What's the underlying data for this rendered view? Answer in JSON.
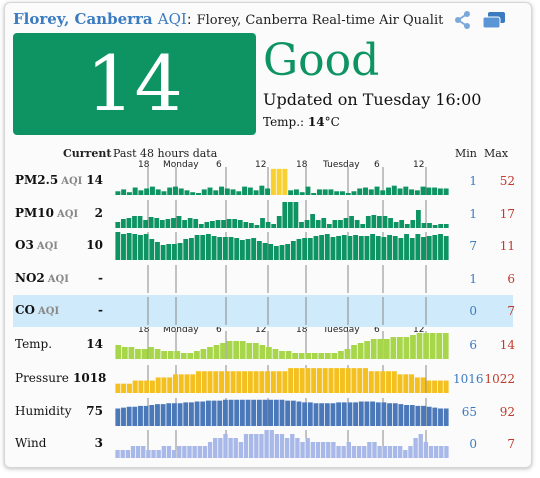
{
  "header": {
    "city": "Florey, Canberra",
    "aqi_word": "AQI",
    "colon": ":",
    "title": "Florey, Canberra Real-time Air Qualit"
  },
  "aqi": {
    "value": "14",
    "level": "Good",
    "updated": "Updated on Tuesday 16:00",
    "temp_label": "Temp.:",
    "temp_value": "14",
    "temp_unit": "°C",
    "color": "#0e9463"
  },
  "columns": {
    "current": "Current",
    "past": "Past 48 hours data",
    "min": "Min",
    "max": "Max"
  },
  "axis": {
    "labels": [
      "18",
      "Monday",
      "6",
      "12",
      "18",
      "Tuesday",
      "6",
      "12"
    ]
  },
  "rows": [
    {
      "name": "PM2.5",
      "unit": "AQI",
      "current": "14",
      "min": "1",
      "max": "52"
    },
    {
      "name": "PM10",
      "unit": "AQI",
      "current": "2",
      "min": "1",
      "max": "17"
    },
    {
      "name": "O3",
      "unit": "AQI",
      "current": "10",
      "min": "7",
      "max": "11"
    },
    {
      "name": "NO2",
      "unit": "AQI",
      "current": "-",
      "min": "1",
      "max": "6"
    },
    {
      "name": "CO",
      "unit": "AQI",
      "current": "-",
      "min": "0",
      "max": "7"
    },
    {
      "name": "Temp.",
      "unit": "",
      "current": "14",
      "min": "6",
      "max": "14"
    },
    {
      "name": "Pressure",
      "unit": "",
      "current": "1018",
      "min": "1016",
      "max": "1022"
    },
    {
      "name": "Humidity",
      "unit": "",
      "current": "75",
      "min": "65",
      "max": "92"
    },
    {
      "name": "Wind",
      "unit": "",
      "current": "3",
      "min": "0",
      "max": "7"
    }
  ],
  "series": {
    "pm25": [
      4,
      6,
      3,
      8,
      5,
      7,
      9,
      6,
      4,
      8,
      9,
      7,
      5,
      3,
      2,
      6,
      8,
      5,
      9,
      7,
      6,
      4,
      9,
      8,
      5,
      10,
      7,
      28,
      28,
      28,
      5,
      6,
      3,
      9,
      2,
      6,
      6,
      6,
      4,
      4,
      2,
      4,
      7,
      8,
      6,
      9,
      5,
      8,
      10,
      7,
      9,
      6,
      5,
      9,
      8,
      8,
      7,
      7
    ],
    "pm10": [
      6,
      9,
      10,
      12,
      12,
      8,
      11,
      10,
      8,
      9,
      10,
      12,
      8,
      10,
      9,
      4,
      6,
      7,
      8,
      8,
      9,
      9,
      8,
      6,
      5,
      3,
      10,
      6,
      4,
      12,
      26,
      26,
      26,
      6,
      8,
      14,
      8,
      10,
      4,
      8,
      8,
      10,
      12,
      8,
      4,
      12,
      13,
      12,
      12,
      10,
      6,
      8,
      4,
      8,
      18,
      5,
      5,
      3,
      4,
      4
    ],
    "o3": [
      28,
      26,
      27,
      26,
      25,
      26,
      21,
      18,
      15,
      16,
      16,
      17,
      21,
      22,
      25,
      25,
      26,
      24,
      23,
      23,
      23,
      22,
      20,
      21,
      22,
      19,
      17,
      16,
      14,
      15,
      16,
      19,
      21,
      22,
      22,
      24,
      25,
      26,
      23,
      24,
      25,
      24,
      25,
      24,
      24,
      26,
      24,
      23,
      25,
      24,
      22,
      26,
      22,
      26,
      23,
      24,
      25,
      26,
      24
    ],
    "temp": [
      7,
      6,
      6,
      5,
      5,
      6,
      5,
      4,
      4,
      4,
      3,
      3,
      4,
      5,
      6,
      7,
      8,
      9,
      9,
      9,
      8,
      8,
      7,
      6,
      5,
      4,
      4,
      3,
      3,
      3,
      3,
      3,
      3,
      3,
      4,
      5,
      7,
      8,
      9,
      10,
      10,
      10,
      11,
      11,
      11,
      12,
      13,
      13,
      13,
      13,
      13
    ],
    "pressure": [
      1017,
      1017,
      1017,
      1018,
      1018,
      1018,
      1018,
      1019,
      1019,
      1019,
      1020,
      1020,
      1020,
      1020,
      1021,
      1021,
      1021,
      1021,
      1021,
      1021,
      1021,
      1021,
      1021,
      1021,
      1021,
      1021,
      1021,
      1021,
      1021,
      1021,
      1022,
      1022,
      1022,
      1022,
      1022,
      1022,
      1022,
      1022,
      1022,
      1022,
      1022,
      1022,
      1022,
      1022,
      1021,
      1021,
      1021,
      1021,
      1021,
      1020,
      1020,
      1020,
      1019,
      1019,
      1018,
      1018,
      1018,
      1018
    ],
    "humidity": [
      80,
      81,
      82,
      82,
      83,
      83,
      84,
      85,
      85,
      86,
      86,
      86,
      87,
      87,
      88,
      88,
      89,
      89,
      89,
      90,
      90,
      90,
      90,
      90,
      90,
      90,
      90,
      90,
      90,
      90,
      89,
      89,
      88,
      87,
      87,
      86,
      86,
      86,
      86,
      87,
      87,
      87,
      87,
      88,
      88,
      88,
      87,
      87,
      86,
      86,
      85,
      84,
      84,
      83,
      83,
      82,
      81,
      80,
      80
    ],
    "wind": [
      2,
      2,
      2,
      3,
      3,
      3,
      2,
      2,
      2,
      3,
      3,
      2,
      3,
      3,
      3,
      3,
      3,
      3,
      4,
      5,
      5,
      6,
      5,
      5,
      4,
      6,
      6,
      6,
      6,
      7,
      7,
      6,
      6,
      5,
      6,
      5,
      4,
      5,
      4,
      4,
      4,
      4,
      4,
      3,
      3,
      4,
      3,
      3,
      3,
      4,
      4,
      3,
      3,
      3,
      3,
      3,
      2,
      3,
      5,
      6,
      4,
      3,
      3,
      3,
      3
    ]
  },
  "colors": {
    "pm": "#0e9463",
    "pm_highlight": "#f8d030",
    "temp": "#a8d64a",
    "pressure": "#f4c020",
    "humidity": "#4a78b8",
    "wind": "#a8b8e8",
    "co_highlight": "#cfeafa",
    "link": "#3b7bbf",
    "max": "#c0392b"
  }
}
